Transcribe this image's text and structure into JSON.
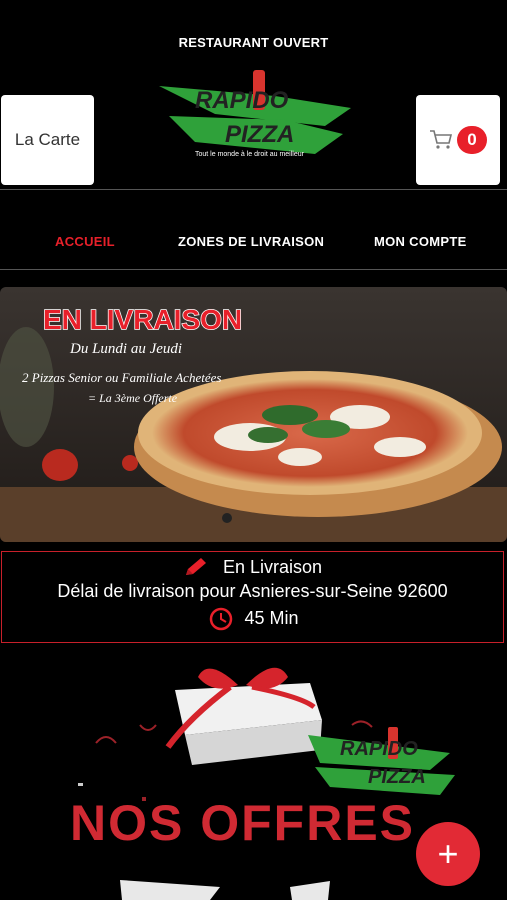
{
  "header": {
    "status": "RESTAURANT OUVERT",
    "menu_button": "La Carte",
    "cart_count": "0",
    "logo_text_top": "RAPIDO",
    "logo_text_bottom": "PIZZA",
    "logo_tagline": "Tout le monde à le droit au meilleur"
  },
  "nav": {
    "items": [
      {
        "label": "ACCUEIL",
        "active": true
      },
      {
        "label": "ZONES DE LIVRAISON",
        "active": false
      },
      {
        "label": "MON COMPTE",
        "active": false
      }
    ]
  },
  "banner": {
    "title": "EN LIVRAISON",
    "subtitle": "Du Lundi au Jeudi",
    "promo_line1": "2 Pizzas Senior ou Familiale Achetées",
    "promo_line2": "= La 3ème Offerte"
  },
  "delivery": {
    "mode": "En Livraison",
    "delay_text": "Délai de livraison pour Asnieres-sur-Seine 92600",
    "duration": "45 Min"
  },
  "offers": {
    "title": "NOS OFFRES",
    "logo_text_top": "RAPIDO",
    "logo_text_bottom": "PIZZA"
  },
  "fab": {
    "icon": "plus-icon"
  },
  "colors": {
    "accent": "#e8202a",
    "background": "#000000"
  }
}
